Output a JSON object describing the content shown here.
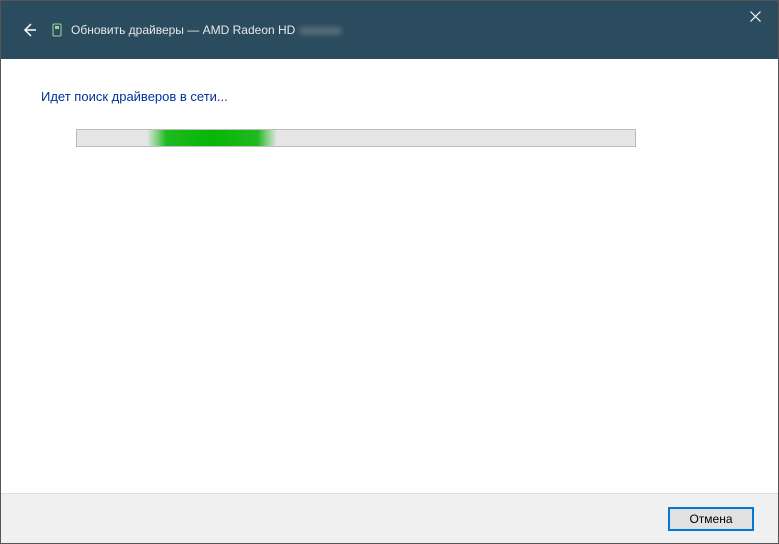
{
  "titlebar": {
    "title_prefix": "Обновить драйверы —",
    "device_name": "AMD Radeon HD",
    "device_suffix": "xxxxxxx"
  },
  "content": {
    "status": "Идет поиск драйверов в сети..."
  },
  "footer": {
    "cancel_label": "Отмена"
  }
}
